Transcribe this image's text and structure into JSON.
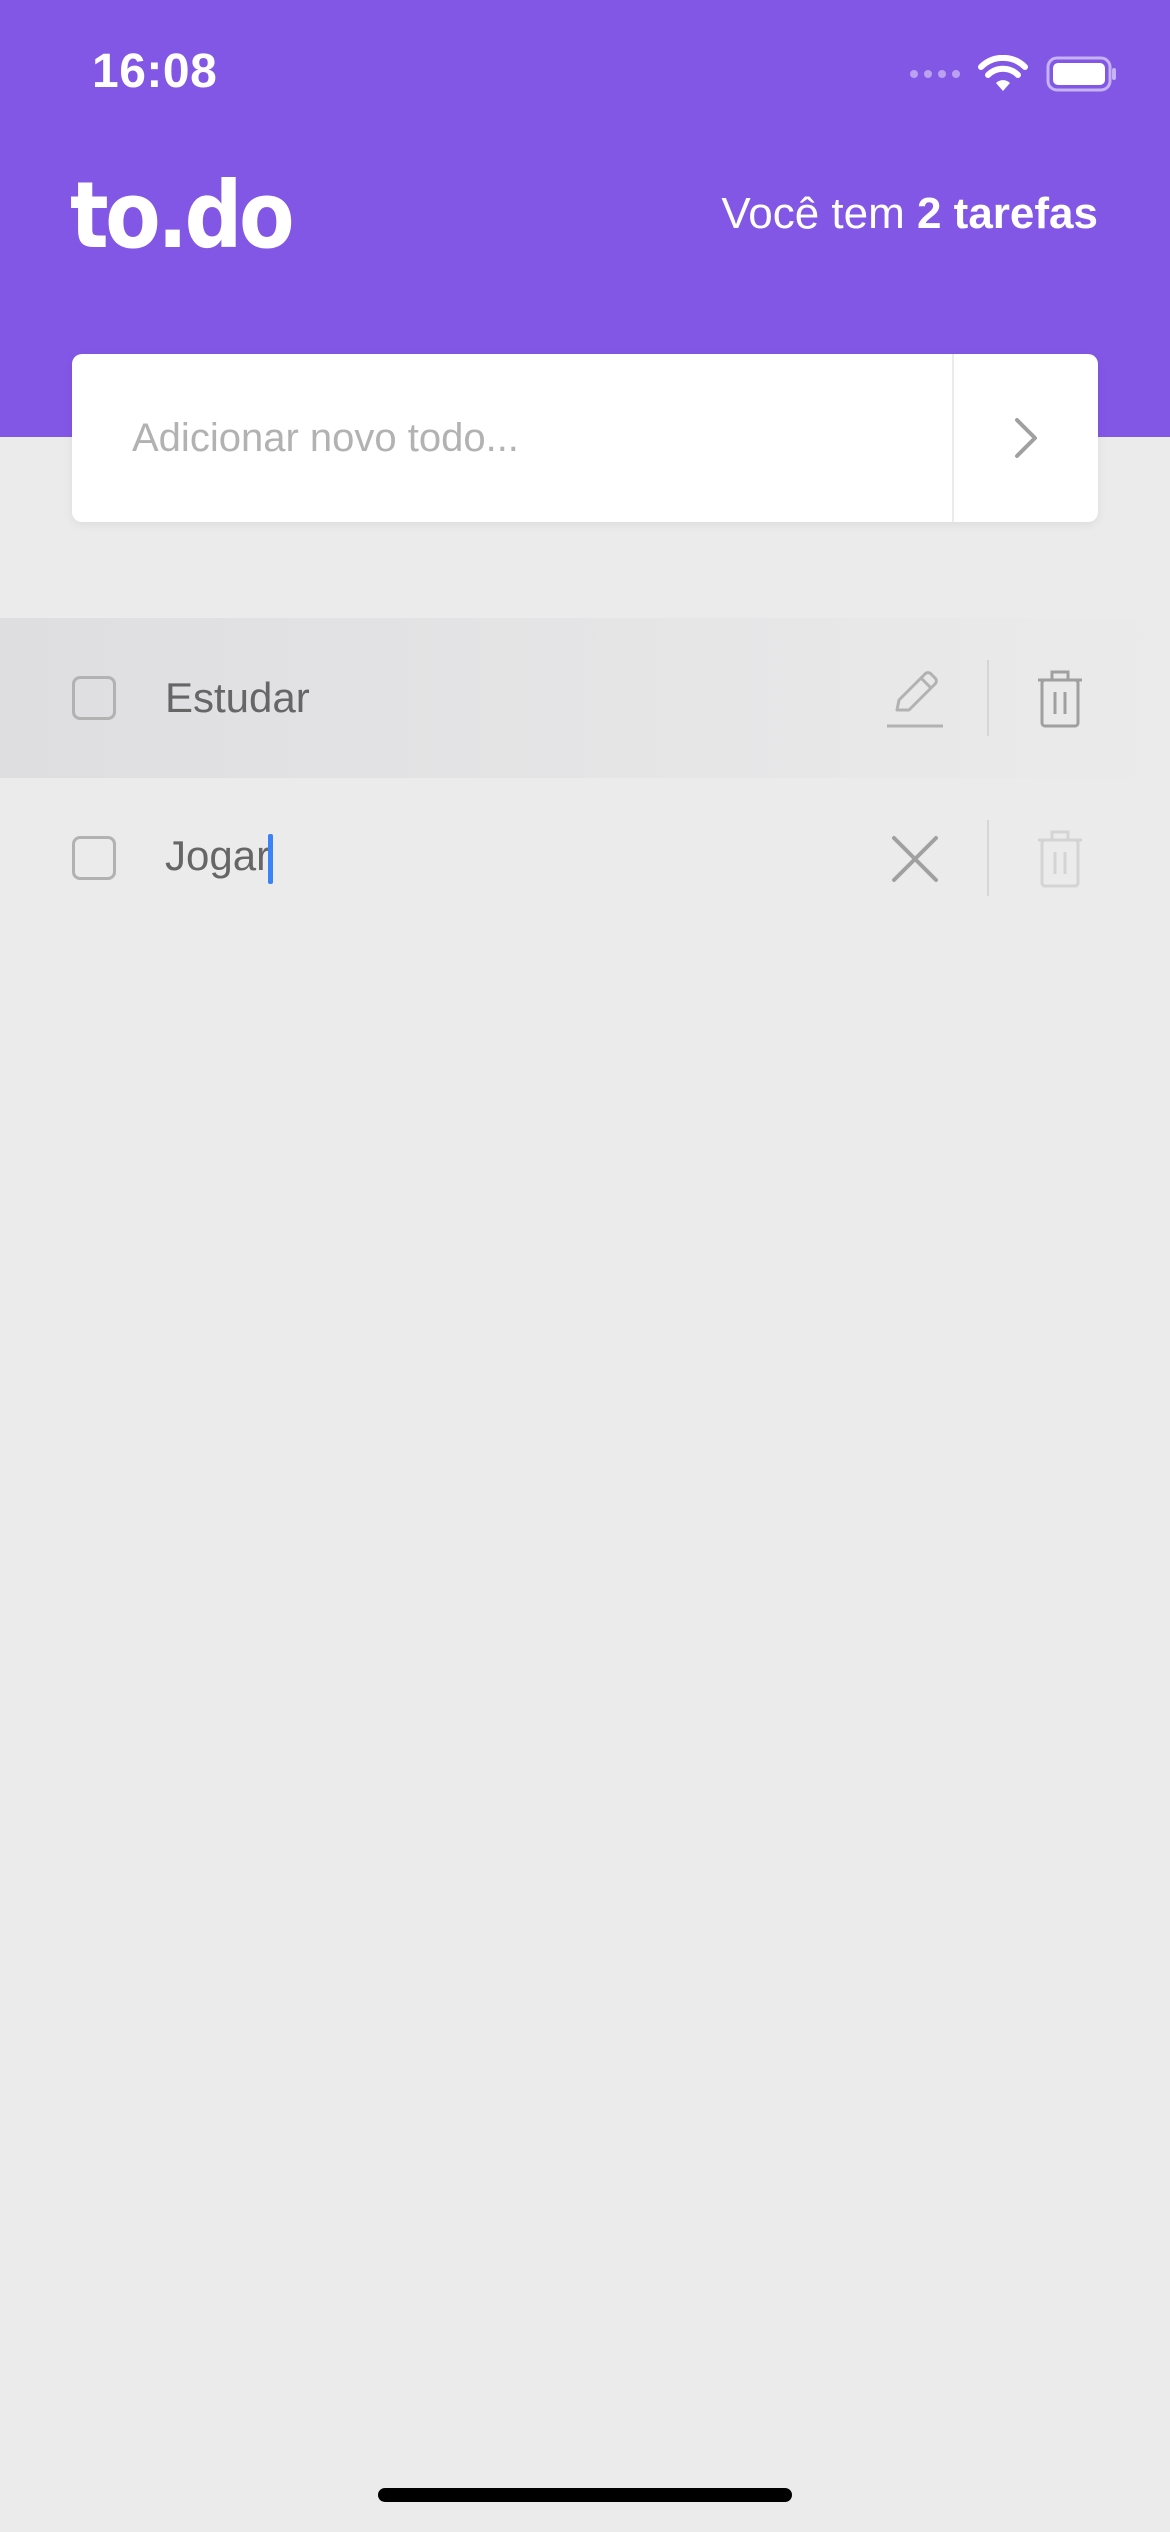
{
  "status_bar": {
    "time": "16:08"
  },
  "header": {
    "logo": "to.do",
    "count_prefix": "Você tem ",
    "count_value": "2 tarefas",
    "background_color": "#8257E5"
  },
  "add_todo": {
    "placeholder": "Adicionar novo todo...",
    "submit_icon": "chevron-right-icon"
  },
  "tasks": [
    {
      "title": "Estudar",
      "done": false,
      "editing": false,
      "action_icon": "pencil-icon",
      "delete_icon": "trash-icon"
    },
    {
      "title": "Jogar",
      "done": false,
      "editing": true,
      "action_icon": "close-icon",
      "delete_icon": "trash-icon"
    }
  ],
  "colors": {
    "accent": "#8257E5",
    "background": "#EBEBEB",
    "text": "#666666",
    "caret": "#3B82F6"
  }
}
